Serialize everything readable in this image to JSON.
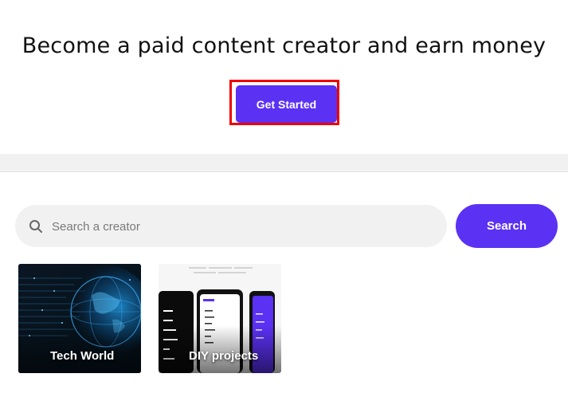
{
  "hero": {
    "title": "Become a paid content creator and earn money",
    "cta_label": "Get Started"
  },
  "search": {
    "placeholder": "Search a creator",
    "button_label": "Search"
  },
  "creators": [
    {
      "title": "Tech World"
    },
    {
      "title": "DIY projects"
    }
  ],
  "colors": {
    "accent": "#5b31f4",
    "highlight": "#ee0000",
    "search_bg": "#f1f1f1"
  }
}
